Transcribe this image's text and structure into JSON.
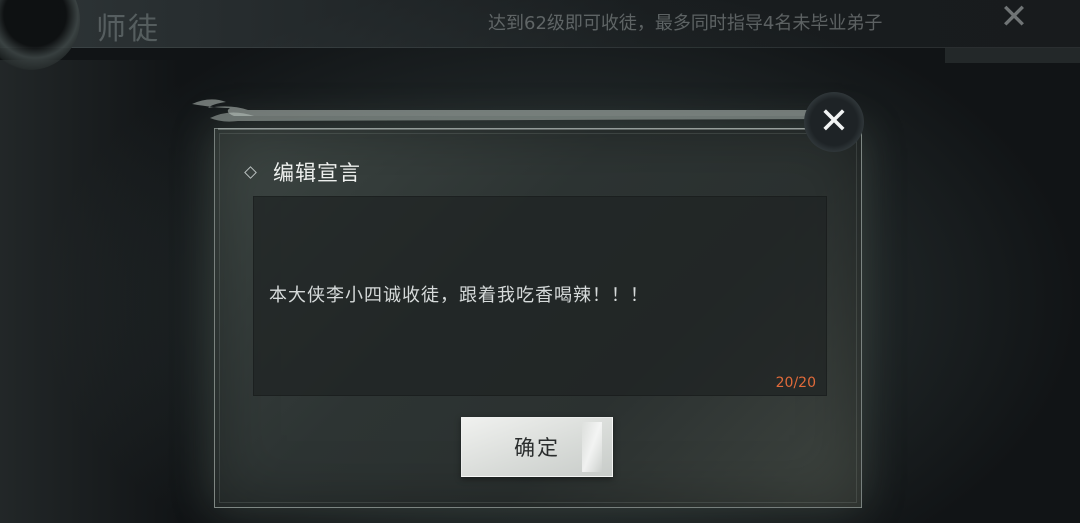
{
  "background": {
    "title": "师徒",
    "hint": "达到62级即可收徒，最多同时指导4名未毕业弟子",
    "close_icon": "close-icon"
  },
  "dialog": {
    "title": "编辑宣言",
    "close_icon": "close-icon",
    "text": "本大侠李小四诚收徒，跟着我吃香喝辣！！！",
    "char_count": "20/20",
    "confirm_label": "确定"
  },
  "colors": {
    "char_count": "#e06a3a",
    "confirm_bg": "#e6e8e5",
    "dialog_bg": "#2d3433"
  }
}
